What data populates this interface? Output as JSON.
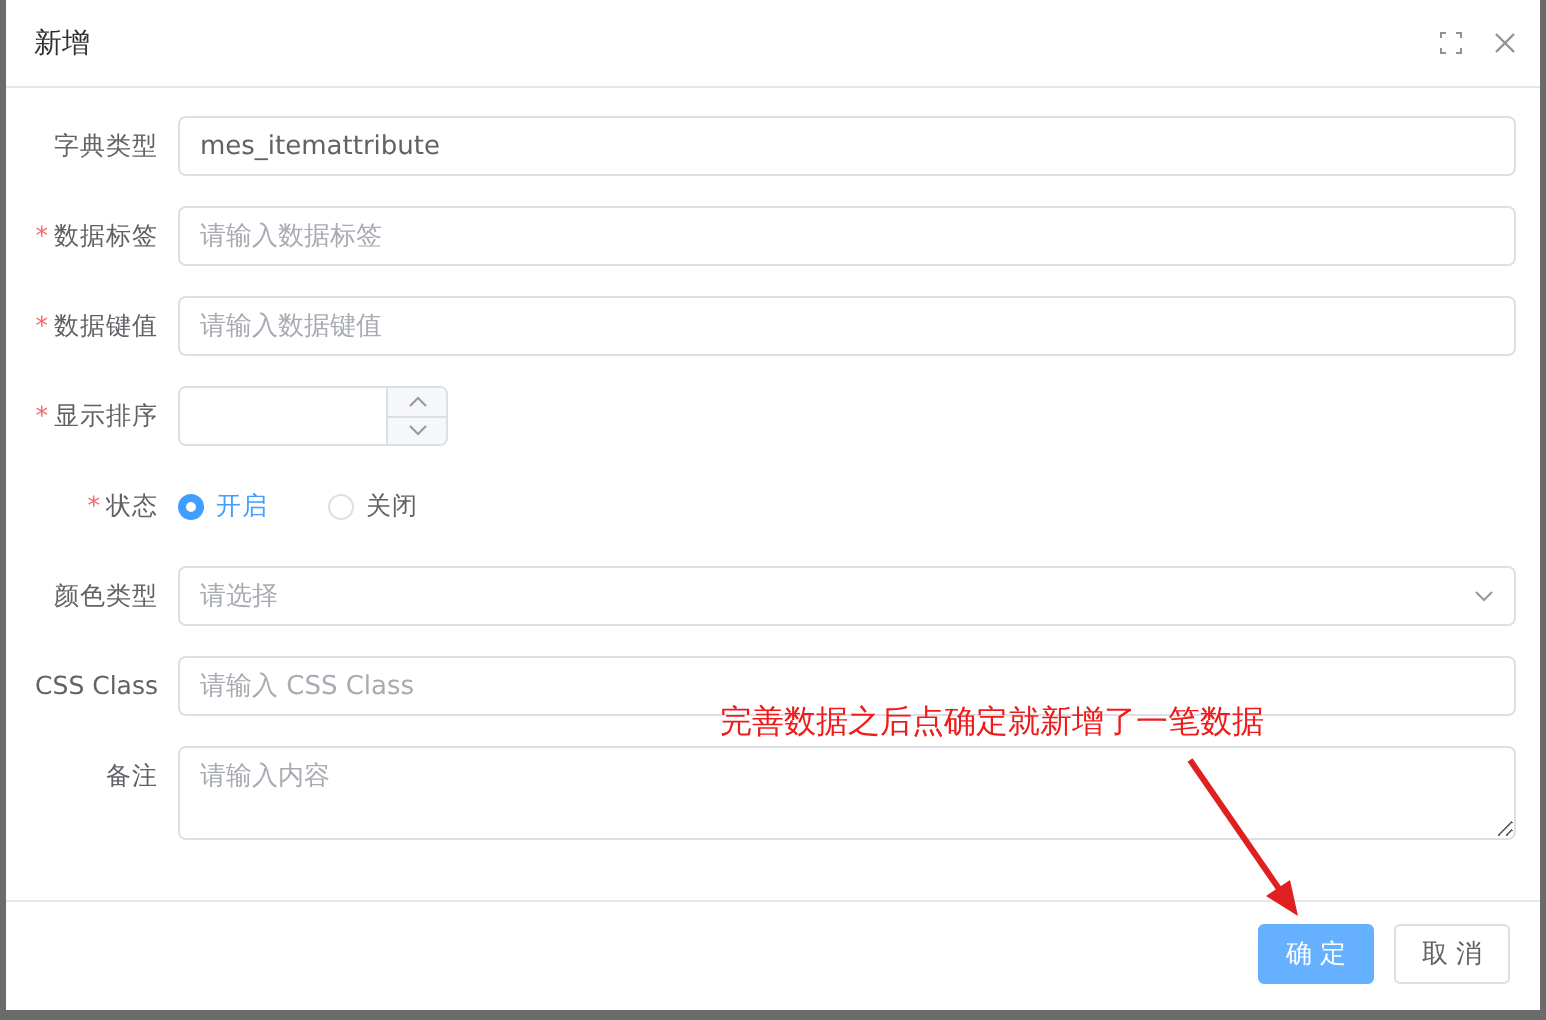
{
  "dialog": {
    "title": "新增"
  },
  "fields": [
    {
      "kind": "text",
      "label": "字典类型",
      "value": "mes_itemattribute"
    },
    {
      "kind": "text",
      "label": "数据标签",
      "required_mark": "*",
      "placeholder": "请输入数据标签"
    },
    {
      "kind": "text",
      "label": "数据键值",
      "required_mark": "*",
      "placeholder": "请输入数据键值"
    },
    {
      "kind": "number",
      "label": "显示排序",
      "required_mark": "*"
    },
    {
      "kind": "radio",
      "label": "状态",
      "required_mark": "*",
      "options": [
        {
          "label": "开启",
          "selected": true
        },
        {
          "label": "关闭",
          "selected": false
        }
      ]
    },
    {
      "kind": "select",
      "label": "颜色类型",
      "placeholder": "请选择"
    },
    {
      "kind": "text",
      "label": "CSS Class",
      "placeholder": "请输入 CSS Class"
    },
    {
      "kind": "textarea",
      "label": "备注",
      "placeholder": "请输入内容"
    }
  ],
  "buttons": [
    {
      "label": "确 定",
      "kind": "primary"
    },
    {
      "label": "取 消",
      "kind": "default"
    }
  ],
  "annotation": {
    "text": "完善数据之后点确定就新增了一笔数据"
  }
}
